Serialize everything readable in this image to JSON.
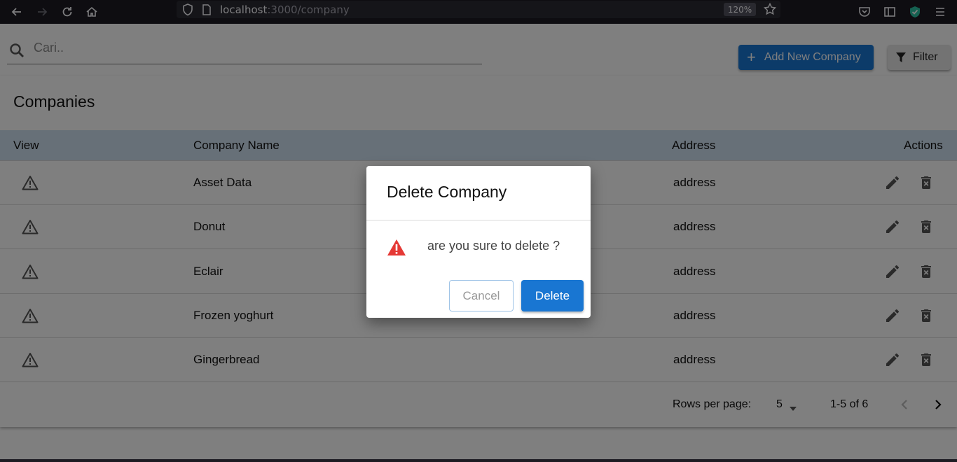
{
  "browser": {
    "url_host": "localhost",
    "url_path": ":3000/company",
    "zoom": "120%"
  },
  "search": {
    "placeholder": "Cari.."
  },
  "toolbar": {
    "add_label": "Add New Company",
    "filter_label": "Filter"
  },
  "page": {
    "title": "Companies"
  },
  "table": {
    "headers": {
      "view": "View",
      "name": "Company Name",
      "address": "Address",
      "actions": "Actions"
    },
    "rows": [
      {
        "name": "Asset Data",
        "address": "address"
      },
      {
        "name": "Donut",
        "address": "address"
      },
      {
        "name": "Eclair",
        "address": "address"
      },
      {
        "name": "Frozen yoghurt",
        "address": "address"
      },
      {
        "name": "Gingerbread",
        "address": "address"
      }
    ]
  },
  "pagination": {
    "rows_per_page_label": "Rows per page:",
    "rows_per_page": "5",
    "range": "1-5 of 6"
  },
  "dialog": {
    "title": "Delete Company",
    "message": "are you sure to delete ?",
    "cancel_label": "Cancel",
    "delete_label": "Delete"
  },
  "colors": {
    "primary": "#1976d2",
    "warning": "#e53935",
    "header_bg": "#cfe0f0"
  },
  "icons": [
    "back-icon",
    "forward-icon",
    "reload-icon",
    "home-icon",
    "shield-icon",
    "page-icon",
    "star-icon",
    "pocket-icon",
    "sidebar-icon",
    "extension-shield-icon",
    "menu-icon",
    "search-icon",
    "plus-icon",
    "filter-icon",
    "warning-icon",
    "edit-icon",
    "delete-icon",
    "dropdown-icon",
    "chevron-left-icon",
    "chevron-right-icon"
  ]
}
